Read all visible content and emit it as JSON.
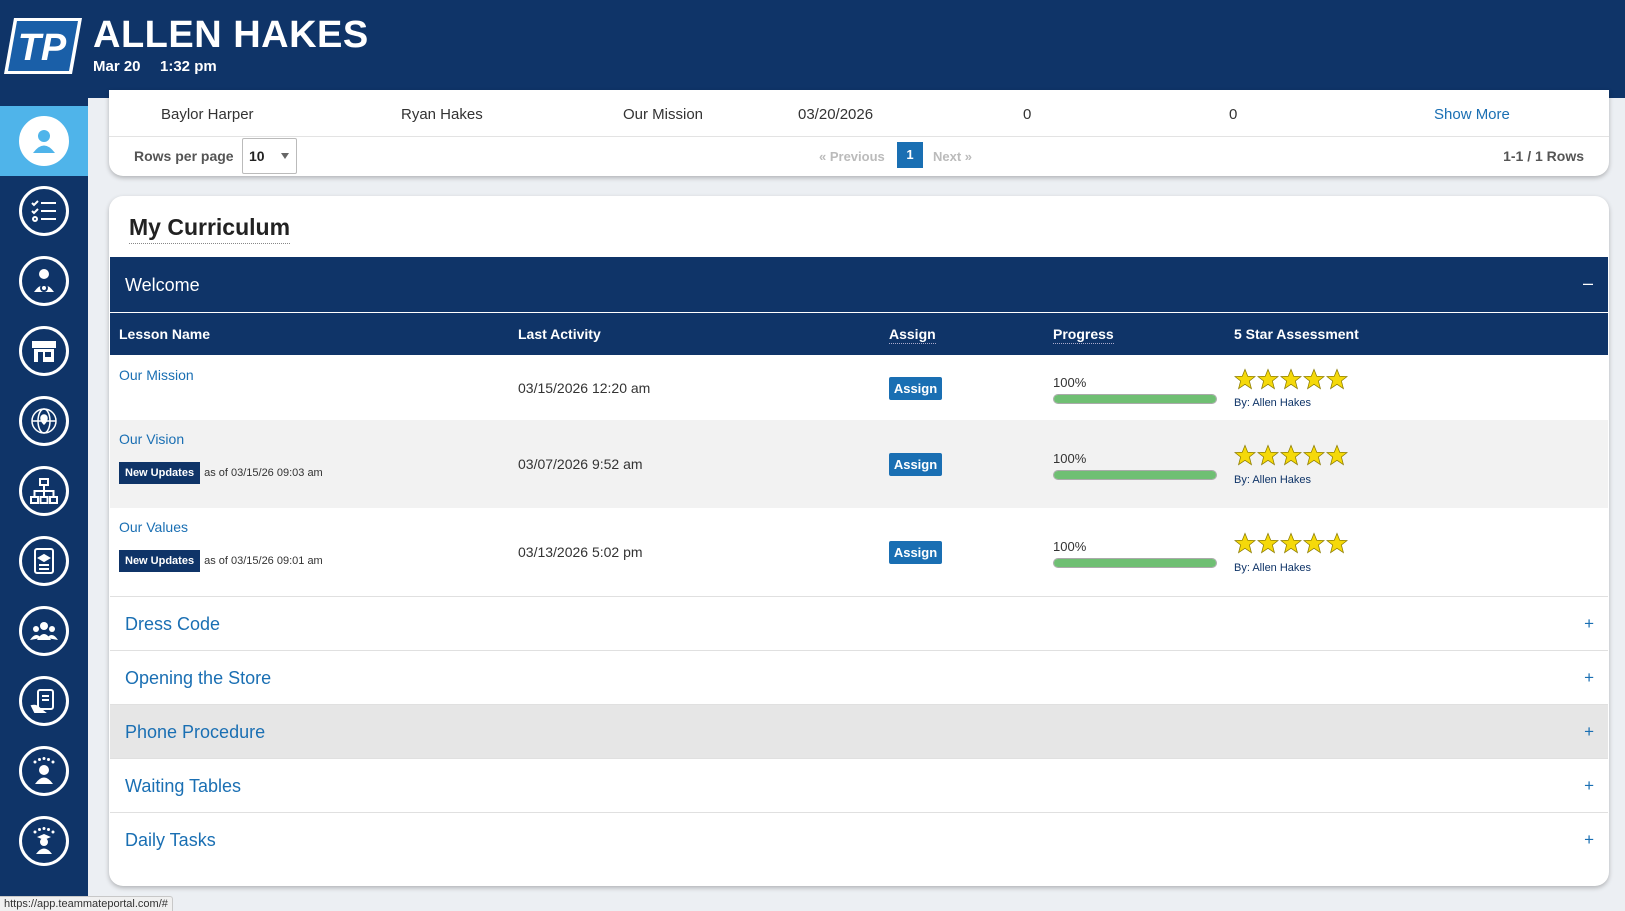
{
  "header": {
    "name": "ALLEN HAKES",
    "date": "Mar 20",
    "time": "1:32 pm",
    "logo_text": "TP"
  },
  "sidebar": {
    "items": [
      {
        "icon": "user-icon",
        "active": true
      },
      {
        "icon": "checklist-icon",
        "active": false
      },
      {
        "icon": "user-settings-icon",
        "active": false
      },
      {
        "icon": "store-icon",
        "active": false
      },
      {
        "icon": "globe-location-icon",
        "active": false
      },
      {
        "icon": "org-chart-icon",
        "active": false
      },
      {
        "icon": "certificate-icon",
        "active": false
      },
      {
        "icon": "team-icon",
        "active": false
      },
      {
        "icon": "clipboard-hand-icon",
        "active": false
      },
      {
        "icon": "star-user-icon",
        "active": false
      },
      {
        "icon": "graduate-stars-icon",
        "active": false
      }
    ]
  },
  "top_table": {
    "row": {
      "col1": "Baylor Harper",
      "col2": "Ryan Hakes",
      "col3": "Our Mission",
      "col4": "03/20/2026",
      "col5": "0",
      "col6": "0",
      "action": "Show More"
    },
    "rows_per_page_label": "Rows per page",
    "rows_per_page_value": "10",
    "previous": "« Previous",
    "current_page": "1",
    "next": "Next »",
    "rows_info": "1-1 / 1 Rows"
  },
  "curriculum": {
    "title": "My Curriculum",
    "open_section": {
      "label": "Welcome",
      "toggle": "–"
    },
    "columns": {
      "lesson": "Lesson Name",
      "activity": "Last Activity",
      "assign": "Assign",
      "progress": "Progress",
      "assessment": "5 Star Assessment"
    },
    "lessons": [
      {
        "name": "Our Mission",
        "update_badge": "",
        "update_text": "",
        "last_activity": "03/15/2026 12:20 am",
        "assign": "Assign",
        "progress_label": "100%",
        "progress": 1.0,
        "stars": 5,
        "by": "By: Allen Hakes"
      },
      {
        "name": "Our Vision",
        "update_badge": "New Updates",
        "update_text": "as of 03/15/26 09:03 am",
        "last_activity": "03/07/2026 9:52 am",
        "assign": "Assign",
        "progress_label": "100%",
        "progress": 1.0,
        "stars": 5,
        "by": "By: Allen Hakes"
      },
      {
        "name": "Our Values",
        "update_badge": "New Updates",
        "update_text": "as of 03/15/26 09:01 am",
        "last_activity": "03/13/2026 5:02 pm",
        "assign": "Assign",
        "progress_label": "100%",
        "progress": 1.0,
        "stars": 5,
        "by": "By: Allen Hakes"
      }
    ],
    "closed_sections": [
      {
        "label": "Dress Code",
        "toggle": "+"
      },
      {
        "label": "Opening the Store",
        "toggle": "+"
      },
      {
        "label": "Phone Procedure",
        "toggle": "+"
      },
      {
        "label": "Waiting Tables",
        "toggle": "+"
      },
      {
        "label": "Daily Tasks",
        "toggle": "+"
      }
    ]
  },
  "status_bar": {
    "url": "https://app.teammateportal.com/#"
  },
  "colors": {
    "navy": "#0f3468",
    "accent": "#4fb4ea",
    "link": "#1a6fb3",
    "progress": "#6fbf73",
    "star": "#f5d90a"
  }
}
